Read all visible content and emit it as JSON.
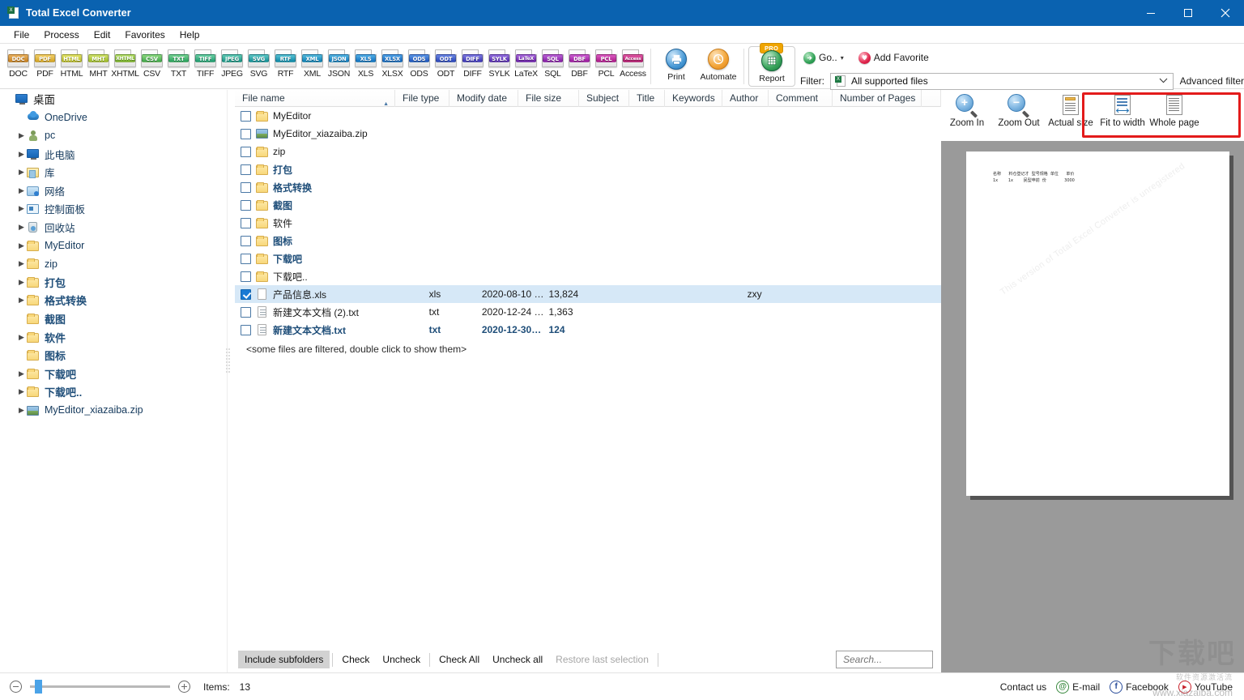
{
  "window": {
    "title": "Total Excel Converter",
    "icon": "excel-app-icon",
    "minimize": "─",
    "maximize": "□",
    "close": "✕"
  },
  "menu": {
    "items": [
      {
        "label": "File"
      },
      {
        "label": "Process"
      },
      {
        "label": "Edit"
      },
      {
        "label": "Favorites"
      },
      {
        "label": "Help"
      }
    ]
  },
  "toolbar": {
    "formats": [
      {
        "label": "DOC",
        "tag": "DOC",
        "c1": "#e8b261",
        "c2": "#c77f1e"
      },
      {
        "label": "PDF",
        "tag": "PDF",
        "c1": "#f1cf6a",
        "c2": "#d4a423"
      },
      {
        "label": "HTML",
        "tag": "HTML",
        "c1": "#e2e36a",
        "c2": "#b6ba27"
      },
      {
        "label": "MHT",
        "tag": "MHT",
        "c1": "#cfe06a",
        "c2": "#9cbb2a"
      },
      {
        "label": "XHTML",
        "tag": "XHTML",
        "c1": "#b6de6a",
        "c2": "#79b32c"
      },
      {
        "label": "CSV",
        "tag": "CSV",
        "c1": "#8ed980",
        "c2": "#3fa64b"
      },
      {
        "label": "TXT",
        "tag": "TXT",
        "c1": "#76d392",
        "c2": "#29a05c"
      },
      {
        "label": "TIFF",
        "tag": "TIFF",
        "c1": "#6bd0a4",
        "c2": "#1f9a6e"
      },
      {
        "label": "JPEG",
        "tag": "JPEG",
        "c1": "#63ccb6",
        "c2": "#169183"
      },
      {
        "label": "SVG",
        "tag": "SVG",
        "c1": "#5fc8c6",
        "c2": "#118e96"
      },
      {
        "label": "RTF",
        "tag": "RTF",
        "c1": "#59c3d4",
        "c2": "#0e86a6"
      },
      {
        "label": "XML",
        "tag": "XML",
        "c1": "#56bcdd",
        "c2": "#0d7db4"
      },
      {
        "label": "JSON",
        "tag": "JSON",
        "c1": "#54b6e2",
        "c2": "#1177bb"
      },
      {
        "label": "XLS",
        "tag": "XLS",
        "c1": "#52afe6",
        "c2": "#1171c0"
      },
      {
        "label": "XLSX",
        "tag": "XLSX",
        "c1": "#4fa3e7",
        "c2": "#1265bf"
      },
      {
        "label": "ODS",
        "tag": "ODS",
        "c1": "#5a96e6",
        "c2": "#1f55bd"
      },
      {
        "label": "ODT",
        "tag": "ODT",
        "c1": "#6b87e4",
        "c2": "#2a45b8"
      },
      {
        "label": "DIFF",
        "tag": "DIFF",
        "c1": "#7e7ce2",
        "c2": "#3c34b4"
      },
      {
        "label": "SYLK",
        "tag": "SYLK",
        "c1": "#9571df",
        "c2": "#5227ae"
      },
      {
        "label": "LaTeX",
        "tag": "LaTeX",
        "c1": "#a96adc",
        "c2": "#6a1fa8"
      },
      {
        "label": "SQL",
        "tag": "SQL",
        "c1": "#bb63d8",
        "c2": "#841ca2"
      },
      {
        "label": "DBF",
        "tag": "DBF",
        "c1": "#cc5fd2",
        "c2": "#9a1a9c"
      },
      {
        "label": "PCL",
        "tag": "PCL",
        "c1": "#db5cc3",
        "c2": "#ac1a86"
      },
      {
        "label": "Access",
        "tag": "Access",
        "c1": "#e15aa8",
        "c2": "#b01a6a"
      }
    ],
    "print": {
      "label": "Print",
      "icon": "printer-icon",
      "color": "#1f7ac0"
    },
    "automate": {
      "label": "Automate",
      "icon": "clock-icon",
      "color": "#ef8f1c"
    },
    "report": {
      "label": "Report",
      "icon": "report-icon",
      "badge": "PRO",
      "color": "#1d8b46"
    },
    "go": {
      "label": "Go..",
      "icon": "go-arrow-icon",
      "caret": "▾",
      "color": "#1f9c4a"
    },
    "add_favorite": {
      "label": "Add Favorite",
      "icon": "heart-icon",
      "color": "#e0234a"
    },
    "filter_label": "Filter:",
    "filter_value": "All supported files",
    "filter_icon": "excel-file-icon",
    "filter_caret": "⌄",
    "advanced_filter": "Advanced filter"
  },
  "tree": {
    "items": [
      {
        "label": "桌面",
        "icon": "desktop-icon",
        "arrow": false,
        "style": "root"
      },
      {
        "label": "OneDrive",
        "icon": "cloud-icon",
        "arrow": false,
        "style": "plain"
      },
      {
        "label": "pc",
        "icon": "user-icon",
        "arrow": true,
        "style": "plain"
      },
      {
        "label": "此电脑",
        "icon": "computer-icon",
        "arrow": true,
        "style": "plain"
      },
      {
        "label": "库",
        "icon": "library-icon",
        "arrow": true,
        "style": "plain"
      },
      {
        "label": "网络",
        "icon": "network-icon",
        "arrow": true,
        "style": "plain"
      },
      {
        "label": "控制面板",
        "icon": "controlpanel-icon",
        "arrow": true,
        "style": "plain"
      },
      {
        "label": "回收站",
        "icon": "recyclebin-icon",
        "arrow": true,
        "style": "plain"
      },
      {
        "label": "MyEditor",
        "icon": "folder-icon",
        "arrow": true,
        "style": "plain"
      },
      {
        "label": "zip",
        "icon": "folder-icon",
        "arrow": true,
        "style": "plain"
      },
      {
        "label": "打包",
        "icon": "folder-icon",
        "arrow": true,
        "style": "cjk"
      },
      {
        "label": "格式转换",
        "icon": "folder-icon",
        "arrow": true,
        "style": "cjk"
      },
      {
        "label": "截图",
        "icon": "folder-icon",
        "arrow": false,
        "style": "cjk"
      },
      {
        "label": "软件",
        "icon": "folder-icon",
        "arrow": true,
        "style": "cjk"
      },
      {
        "label": "图标",
        "icon": "folder-icon",
        "arrow": false,
        "style": "cjk"
      },
      {
        "label": "下载吧",
        "icon": "folder-icon",
        "arrow": true,
        "style": "cjk"
      },
      {
        "label": "下载吧..",
        "icon": "folder-icon",
        "arrow": true,
        "style": "cjk"
      },
      {
        "label": "MyEditor_xiazaiba.zip",
        "icon": "zip-icon",
        "arrow": true,
        "style": "plain"
      }
    ]
  },
  "filelist": {
    "columns": [
      {
        "label": "File name",
        "key": "name",
        "sorted": true,
        "sort_mark": "▲"
      },
      {
        "label": "File type",
        "key": "type"
      },
      {
        "label": "Modify date",
        "key": "date"
      },
      {
        "label": "File size",
        "key": "size"
      },
      {
        "label": "Subject",
        "key": "subject"
      },
      {
        "label": "Title",
        "key": "title"
      },
      {
        "label": "Keywords",
        "key": "keywords"
      },
      {
        "label": "Author",
        "key": "author"
      },
      {
        "label": "Comment",
        "key": "comment"
      },
      {
        "label": "Number of Pages",
        "key": "pages"
      }
    ],
    "rows": [
      {
        "name": "MyEditor",
        "icon": "folder-icon",
        "checked": false,
        "selected": false,
        "bold": false,
        "type": "",
        "date": "",
        "size": "",
        "subject": "",
        "title": "",
        "keywords": "",
        "author": "",
        "comment": "",
        "pages": ""
      },
      {
        "name": "MyEditor_xiazaiba.zip",
        "icon": "zip-icon",
        "checked": false,
        "selected": false,
        "bold": false,
        "type": "",
        "date": "",
        "size": "",
        "subject": "",
        "title": "",
        "keywords": "",
        "author": "",
        "comment": "",
        "pages": ""
      },
      {
        "name": "zip",
        "icon": "folder-icon",
        "checked": false,
        "selected": false,
        "bold": false,
        "type": "",
        "date": "",
        "size": "",
        "subject": "",
        "title": "",
        "keywords": "",
        "author": "",
        "comment": "",
        "pages": ""
      },
      {
        "name": "打包",
        "icon": "folder-icon",
        "checked": false,
        "selected": false,
        "bold": true,
        "type": "",
        "date": "",
        "size": "",
        "subject": "",
        "title": "",
        "keywords": "",
        "author": "",
        "comment": "",
        "pages": ""
      },
      {
        "name": "格式转换",
        "icon": "folder-icon",
        "checked": false,
        "selected": false,
        "bold": true,
        "type": "",
        "date": "",
        "size": "",
        "subject": "",
        "title": "",
        "keywords": "",
        "author": "",
        "comment": "",
        "pages": ""
      },
      {
        "name": "截图",
        "icon": "folder-icon",
        "checked": false,
        "selected": false,
        "bold": true,
        "type": "",
        "date": "",
        "size": "",
        "subject": "",
        "title": "",
        "keywords": "",
        "author": "",
        "comment": "",
        "pages": ""
      },
      {
        "name": "软件",
        "icon": "folder-icon",
        "checked": false,
        "selected": false,
        "bold": false,
        "type": "",
        "date": "",
        "size": "",
        "subject": "",
        "title": "",
        "keywords": "",
        "author": "",
        "comment": "",
        "pages": ""
      },
      {
        "name": "图标",
        "icon": "folder-icon",
        "checked": false,
        "selected": false,
        "bold": true,
        "type": "",
        "date": "",
        "size": "",
        "subject": "",
        "title": "",
        "keywords": "",
        "author": "",
        "comment": "",
        "pages": ""
      },
      {
        "name": "下载吧",
        "icon": "folder-icon",
        "checked": false,
        "selected": false,
        "bold": true,
        "type": "",
        "date": "",
        "size": "",
        "subject": "",
        "title": "",
        "keywords": "",
        "author": "",
        "comment": "",
        "pages": ""
      },
      {
        "name": "下载吧..",
        "icon": "folder-icon",
        "checked": false,
        "selected": false,
        "bold": false,
        "type": "",
        "date": "",
        "size": "",
        "subject": "",
        "title": "",
        "keywords": "",
        "author": "",
        "comment": "",
        "pages": ""
      },
      {
        "name": "产品信息.xls",
        "icon": "file-icon",
        "checked": true,
        "selected": true,
        "bold": false,
        "type": "xls",
        "date": "2020-08-10 …",
        "size": "13,824",
        "subject": "",
        "title": "",
        "keywords": "",
        "author": "zxy",
        "comment": "",
        "pages": ""
      },
      {
        "name": "新建文本文档 (2).txt",
        "icon": "text-icon",
        "checked": false,
        "selected": false,
        "bold": false,
        "type": "txt",
        "date": "2020-12-24 …",
        "size": "1,363",
        "subject": "",
        "title": "",
        "keywords": "",
        "author": "",
        "comment": "",
        "pages": ""
      },
      {
        "name": "新建文本文档.txt",
        "icon": "text-icon",
        "checked": false,
        "selected": false,
        "bold": true,
        "type": "txt",
        "date": "2020-12-30…",
        "size": "124",
        "subject": "",
        "title": "",
        "keywords": "",
        "author": "",
        "comment": "",
        "pages": ""
      }
    ],
    "filtered_note": "<some files are filtered, double click to show them>"
  },
  "list_footer": {
    "buttons": [
      {
        "label": "Include subfolders",
        "state": "active"
      },
      {
        "label": "Check",
        "state": "normal"
      },
      {
        "label": "Uncheck",
        "state": "normal"
      },
      {
        "label": "Check All",
        "state": "normal"
      },
      {
        "label": "Uncheck all",
        "state": "normal"
      },
      {
        "label": "Restore last selection",
        "state": "disabled"
      }
    ],
    "search_placeholder": "Search...",
    "search_value": ""
  },
  "preview": {
    "buttons": [
      {
        "label": "Zoom In",
        "icon": "zoom-in-icon",
        "highlighted": false
      },
      {
        "label": "Zoom Out",
        "icon": "zoom-out-icon",
        "highlighted": false
      },
      {
        "label": "Actual size",
        "icon": "actual-size-icon",
        "highlighted": true
      },
      {
        "label": "Fit to width",
        "icon": "fit-to-width-icon",
        "highlighted": true
      },
      {
        "label": "Whole page",
        "icon": "whole-page-icon",
        "highlighted": true
      }
    ],
    "highlight_color": "#e31b1b",
    "background_color": "#9a9a9a",
    "document": {
      "table_text": "名称      料仓登记才  型号规格  单位      单价\n1x        1x        民型申前  份              3000",
      "watermark": "This version of Total Excel Converter is unregistered"
    }
  },
  "status_bar": {
    "zoom_out_icon": "zoom-minus-icon",
    "zoom_in_icon": "zoom-plus-icon",
    "slider_value": 4,
    "items_label": "Items:",
    "items_count": "13",
    "contact_label": "Contact us",
    "links": [
      {
        "label": "E-mail",
        "icon": "email-icon",
        "glyph": "@",
        "color": "#3a8a3f"
      },
      {
        "label": "Facebook",
        "icon": "facebook-icon",
        "glyph": "f",
        "color": "#2a4d9b"
      },
      {
        "label": "YouTube",
        "icon": "youtube-icon",
        "glyph": "▶",
        "color": "#c8202a"
      }
    ]
  },
  "watermark": {
    "big": "下载吧",
    "sub": "软件资源激活流",
    "url": "www.xiazaiba.com"
  }
}
